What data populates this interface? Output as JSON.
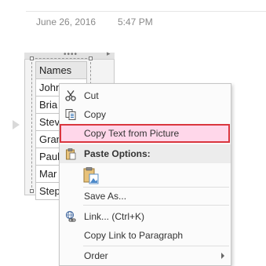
{
  "note": {
    "date": "June 26, 2016",
    "time": "5:47 PM"
  },
  "picture": {
    "header": "Names",
    "rows": [
      "John",
      "Bria",
      "Stev",
      "Gran",
      "Paul",
      "Mar",
      "Step"
    ]
  },
  "context_menu": {
    "items": [
      {
        "label": "Cut",
        "icon": "scissors-icon"
      },
      {
        "label": "Copy",
        "icon": "copy-icon"
      },
      {
        "label": "Copy Text from Picture",
        "icon": "",
        "highlighted": true
      },
      {
        "label": "Paste Options:",
        "icon": "clipboard-icon"
      },
      {
        "label": "Save As...",
        "icon": ""
      },
      {
        "label": "Link...  (Ctrl+K)",
        "icon": "link-icon"
      },
      {
        "label": "Copy Link to Paragraph",
        "icon": ""
      },
      {
        "label": "Order",
        "icon": ""
      }
    ]
  },
  "colors": {
    "highlight_bg": "#ffd7ea",
    "highlight_border": "#d9363e"
  }
}
